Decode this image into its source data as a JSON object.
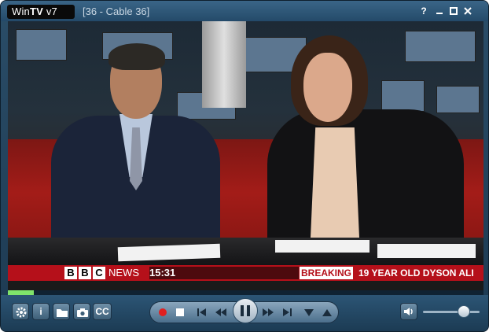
{
  "window": {
    "logo_prefix": "Win",
    "logo_bold": "TV",
    "logo_suffix": " v7",
    "channel_title": "[36 - Cable 36]",
    "help_label": "?",
    "minimize_icon": "minimize-icon",
    "maximize_icon": "maximize-icon",
    "close_icon": "close-icon"
  },
  "broadcast": {
    "bbc_letters": [
      "B",
      "B",
      "C"
    ],
    "network": "NEWS",
    "time": "15:31",
    "breaking_label": "BREAKING",
    "headline": "19 YEAR OLD DYSON ALI"
  },
  "playback": {
    "progress_fraction": 0.055,
    "volume_fraction": 0.72
  },
  "controls": {
    "settings_icon": "gear-icon",
    "info_label": "i",
    "folder_icon": "folder-icon",
    "snapshot_icon": "camera-icon",
    "cc_label": "CC",
    "record_icon": "record-icon",
    "stop_icon": "stop-icon",
    "skip_back_icon": "skip-back-icon",
    "rewind_icon": "rewind-icon",
    "pause_icon": "pause-icon",
    "fast_forward_icon": "fast-forward-icon",
    "skip_forward_icon": "skip-forward-icon",
    "channel_down_icon": "channel-down-icon",
    "channel_up_icon": "channel-up-icon",
    "volume_icon": "volume-icon",
    "record_color": "#e02020",
    "accent_color": "#7fe36b"
  }
}
